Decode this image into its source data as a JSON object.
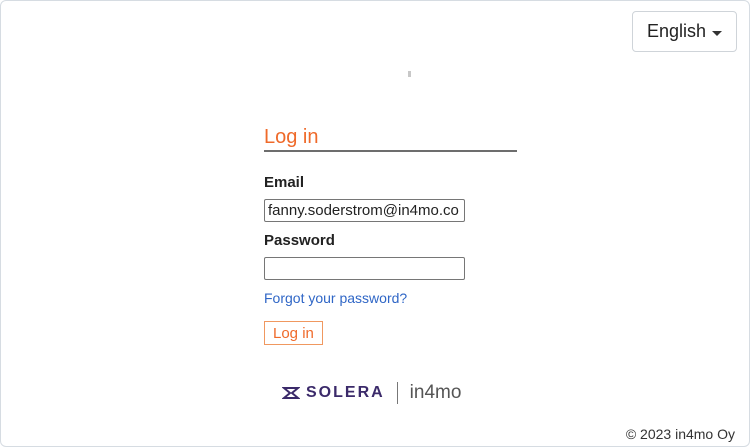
{
  "language": {
    "selected": "English"
  },
  "login": {
    "title": "Log in",
    "email_label": "Email",
    "email_value": "fanny.soderstrom@in4mo.co",
    "password_label": "Password",
    "password_value": "",
    "forgot_link": "Forgot your password?",
    "submit_label": "Log in"
  },
  "branding": {
    "solera_text": "SOLERA",
    "partner_text": "in4mo",
    "colors": {
      "accent": "#ef6a2a",
      "link": "#2f66c6",
      "solera": "#3b2a6a"
    }
  },
  "footer": {
    "copyright": "© 2023 in4mo Oy"
  }
}
